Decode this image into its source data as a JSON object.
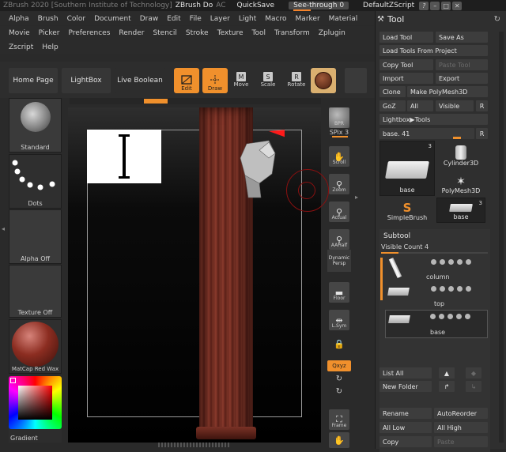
{
  "titlebar": {
    "app": "ZBrush 2020 [Southern Institute of Technology]",
    "doc": "ZBrush Do",
    "ac": "AC",
    "quicksave": "QuickSave",
    "seethrough": "See-through  0",
    "material": "DefaultZScript"
  },
  "menu": {
    "row1": [
      "Alpha",
      "Brush",
      "Color",
      "Document",
      "Draw",
      "Edit",
      "File",
      "Layer",
      "Light",
      "Macro",
      "Marker",
      "Material"
    ],
    "row2": [
      "Movie",
      "Picker",
      "Preferences",
      "Render",
      "Stencil",
      "Stroke",
      "Texture",
      "Tool",
      "Transform",
      "Zplugin"
    ],
    "row3": [
      "Zscript",
      "Help"
    ]
  },
  "shelf": {
    "home_page": "Home Page",
    "lightbox": "LightBox",
    "live_boolean": "Live Boolean",
    "edit": "Edit",
    "draw": "Draw",
    "move": "Move",
    "scale": "Scale",
    "rotate": "Rotate"
  },
  "left_tray": {
    "standard": "Standard",
    "dots": "Dots",
    "alpha_off": "Alpha Off",
    "texture_off": "Texture Off",
    "matcap": "MatCap Red Wax",
    "gradient": "Gradient"
  },
  "right_tray": {
    "bpr": "BPR",
    "spix_label": "SPix 3",
    "scroll": "Scroll",
    "zoom": "Zoom",
    "actual": "Actual",
    "aahalf": "AAHalf",
    "dynamic": "Dynamic",
    "persp": "Persp",
    "floor": "Floor",
    "lsym": "L.Sym",
    "xyz": "Qxyz",
    "frame": "Frame"
  },
  "tool_panel": {
    "title": "Tool",
    "load_tool": "Load Tool",
    "save_as": "Save As",
    "load_from_project": "Load Tools From Project",
    "copy_tool": "Copy Tool",
    "paste_tool": "Paste Tool",
    "import": "Import",
    "export": "Export",
    "clone": "Clone",
    "make_polymesh": "Make PolyMesh3D",
    "goz": "GoZ",
    "all": "All",
    "visible": "Visible",
    "r": "R",
    "lightbox_tools": "Lightbox▶Tools",
    "base_label": "base. 41",
    "tiles": [
      {
        "label": "base",
        "count": "3"
      },
      {
        "label": "Cylinder3D",
        "count": ""
      },
      {
        "label": "PolyMesh3D",
        "count": ""
      },
      {
        "label": "SimpleBrush",
        "count": ""
      },
      {
        "label": "base",
        "count": "3"
      }
    ],
    "subtool_title": "Subtool",
    "visible_count": "Visible Count 4",
    "subtools": [
      "column",
      "top",
      "base"
    ],
    "list_all": "List All",
    "new_folder": "New Folder",
    "rename": "Rename",
    "autoreorder": "AutoReorder",
    "all_low": "All Low",
    "all_high": "All High",
    "copy": "Copy",
    "paste": "Paste"
  },
  "colors": {
    "accent": "#f0902c",
    "panel": "#2f2f2f",
    "canvas": "#0c0c0c"
  }
}
